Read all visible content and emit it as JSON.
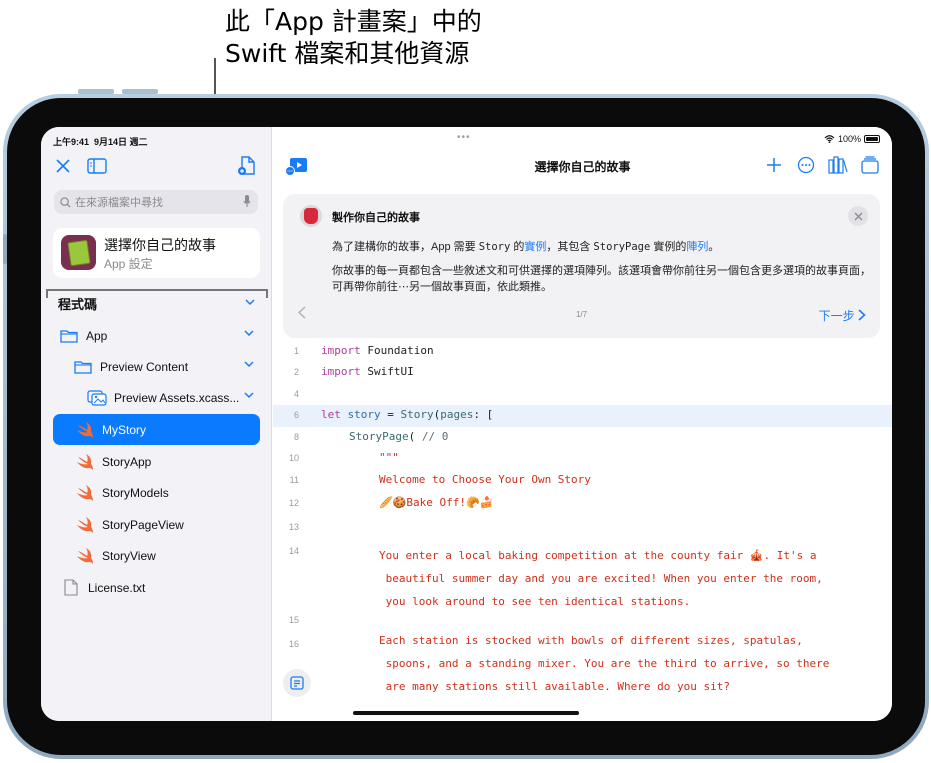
{
  "callout": {
    "line1": "此「App 計畫案」中的",
    "line2": "Swift 檔案和其他資源"
  },
  "status_bar": {
    "time": "上午9:41",
    "date": "9月14日 週二",
    "battery": "100%"
  },
  "sidebar": {
    "search_placeholder": "在來源檔案中尋找",
    "project": {
      "title": "選擇你自己的故事",
      "subtitle": "App 設定"
    },
    "section_title": "程式碼",
    "items": [
      {
        "label": "App",
        "icon": "folder-icon",
        "level": 0,
        "expandable": true
      },
      {
        "label": "Preview Content",
        "icon": "folder-icon",
        "level": 1,
        "expandable": true
      },
      {
        "label": "Preview Assets.xcass...",
        "icon": "image-asset-icon",
        "level": 2,
        "expandable": true
      },
      {
        "label": "MyStory",
        "icon": "swift-icon",
        "level": 1,
        "selected": true
      },
      {
        "label": "StoryApp",
        "icon": "swift-icon",
        "level": 1
      },
      {
        "label": "StoryModels",
        "icon": "swift-icon",
        "level": 1
      },
      {
        "label": "StoryPageView",
        "icon": "swift-icon",
        "level": 1
      },
      {
        "label": "StoryView",
        "icon": "swift-icon",
        "level": 1
      },
      {
        "label": "License.txt",
        "icon": "document-icon",
        "level": 0
      }
    ]
  },
  "main": {
    "title": "選擇你自己的故事",
    "guide": {
      "title": "製作你自己的故事",
      "p1_a": "為了建構你的故事，App 需要 ",
      "p1_code1": "Story",
      "p1_b": " 的",
      "p1_link1": "實例",
      "p1_c": "，其包含 ",
      "p1_code2": "StoryPage",
      "p1_d": " 實例的",
      "p1_link2": "陣列",
      "p1_e": "。",
      "p2": "你故事的每一頁都包含一些敘述文和可供選擇的選項陣列。該選項會帶你前往另一個包含更多選項的故事頁面，可再帶你前往⋯另一個故事頁面，依此類推。",
      "page": "1/7",
      "next_label": "下一步"
    },
    "code": {
      "lines": [
        {
          "n": "1",
          "kw": "import",
          "rest": " Foundation"
        },
        {
          "n": "2",
          "kw": "import",
          "rest": " SwiftUI"
        },
        {
          "n": "4"
        },
        {
          "n": "6",
          "kw": "let",
          "id": " story",
          "op": " = ",
          "ty": "Story",
          "p": "(",
          "arg": "pages",
          "end": ": ["
        },
        {
          "n": "8",
          "ty": "StoryPage",
          "rest": "( ",
          "cmt": "// 0"
        },
        {
          "n": "10",
          "str": "\"\"\""
        },
        {
          "n": "11",
          "str": "Welcome to Choose Your Own Story"
        },
        {
          "n": "12",
          "str": "🥖🍪Bake Off!🥐🍰"
        },
        {
          "n": "13"
        },
        {
          "n": "14"
        },
        {
          "n": "15"
        },
        {
          "n": "16"
        }
      ],
      "para14": "You enter a local baking competition at the county fair 🎪. It's a\n beautiful summer day and you are excited! When you enter the room,\n you look around to see ten identical stations.",
      "para16": "Each station is stocked with bowls of different sizes, spatulas,\n spoons, and a standing mixer. You are the third to arrive, so there\n are many stations still available. Where do you sit?"
    }
  }
}
